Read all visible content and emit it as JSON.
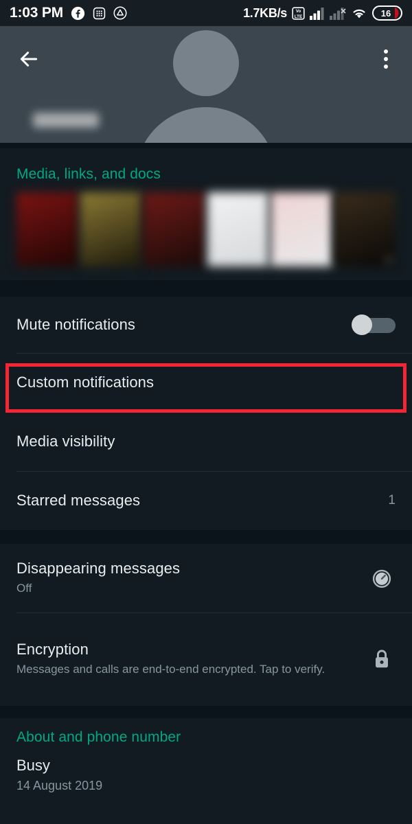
{
  "status_bar": {
    "time": "1:03 PM",
    "icons_left": [
      "facebook-icon",
      "grid-app-icon",
      "drive-triangle-icon"
    ],
    "network_speed": "1.7KB/s",
    "volte_label": "VoLTE",
    "icons_right": [
      "volte-icon",
      "signal-bars-icon",
      "signal-bars-no-service-icon",
      "wifi-icon",
      "battery-icon"
    ],
    "battery_level": "16"
  },
  "header": {
    "back_icon": "back-arrow-icon",
    "menu_icon": "overflow-menu-icon",
    "contact_name": "",
    "avatar": "default-person-avatar"
  },
  "media_section": {
    "title": "Media, links, and docs",
    "thumbs": [
      {
        "color1": "#7c1312",
        "color2": "#210604",
        "count": ""
      },
      {
        "color1": "#8d7a33",
        "color2": "#1d1a0c",
        "count": ""
      },
      {
        "color1": "#6e1a16",
        "color2": "#1a0a09",
        "count": ""
      },
      {
        "color1": "#f1f2f3",
        "color2": "#d6d8da",
        "count": ""
      },
      {
        "color1": "#efd4d4",
        "color2": "#e8e9ea",
        "count": ""
      },
      {
        "color1": "#3a2c1c",
        "color2": "#090806",
        "count": "0"
      }
    ]
  },
  "notification_section": {
    "rows": [
      {
        "title": "Mute notifications",
        "accessory": "toggle-switch",
        "toggle_on": false
      },
      {
        "title": "Custom notifications",
        "accessory": "none",
        "highlighted": true
      },
      {
        "title": "Media visibility",
        "accessory": "none"
      },
      {
        "title": "Starred messages",
        "value": "1",
        "accessory": "none"
      }
    ]
  },
  "privacy_section": {
    "rows": [
      {
        "title": "Disappearing messages",
        "subtitle": "Off",
        "accessory": "timer-icon"
      },
      {
        "title": "Encryption",
        "subtitle": "Messages and calls are end-to-end encrypted. Tap to verify.",
        "accessory": "lock-icon"
      }
    ]
  },
  "about_section": {
    "title": "About and phone number",
    "status_text": "Busy",
    "status_date": "14 August 2019"
  },
  "colors": {
    "accent_teal": "#00a884",
    "highlight_red": "#f42534",
    "card_bg": "#121b21",
    "page_bg": "#0b141a",
    "header_bg": "#3b464e",
    "primary_text": "#e9edef",
    "secondary_text": "#8696a0"
  }
}
